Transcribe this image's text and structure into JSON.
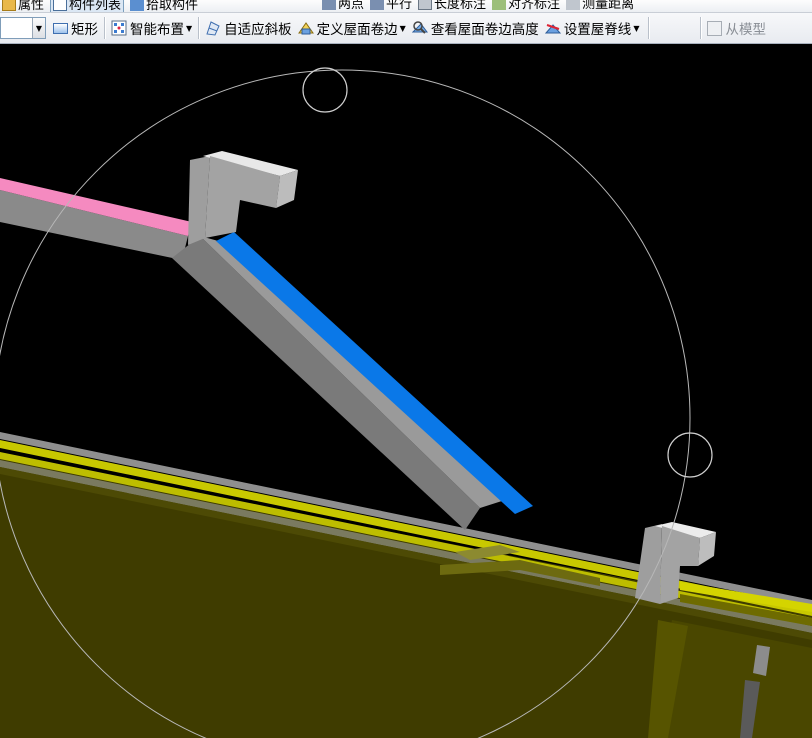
{
  "top_toolbar": {
    "left_items": [
      {
        "label": "属性",
        "icon": "properties-icon"
      },
      {
        "label": "构件列表",
        "icon": "component-list-icon"
      },
      {
        "label": "拾取构件",
        "icon": "pick-component-icon"
      }
    ],
    "right_items": [
      {
        "label": "两点",
        "icon": "two-point-icon"
      },
      {
        "label": "平行",
        "icon": "parallel-icon"
      },
      {
        "label": "长度标注",
        "icon": "length-annotation-icon"
      },
      {
        "label": "对齐标注",
        "icon": "align-annotation-icon"
      },
      {
        "label": "测量距离",
        "icon": "measure-distance-icon"
      }
    ]
  },
  "main_toolbar": {
    "combo_value": "",
    "buttons": [
      {
        "label": "矩形",
        "icon": "rectangle-icon",
        "dropdown": false
      },
      {
        "label": "智能布置",
        "icon": "smart-layout-icon",
        "dropdown": true
      },
      {
        "label": "自适应斜板",
        "icon": "adaptive-slab-icon",
        "dropdown": false
      },
      {
        "label": "定义屋面卷边",
        "icon": "define-roof-edge-icon",
        "dropdown": true
      },
      {
        "label": "查看屋面卷边高度",
        "icon": "view-edge-height-icon",
        "dropdown": false
      },
      {
        "label": "设置屋脊线",
        "icon": "set-ridge-line-icon",
        "dropdown": true
      }
    ],
    "right_button": {
      "label": "从模型",
      "icon": "from-model-icon"
    }
  },
  "colors": {
    "background": "#000000",
    "roof_pink": "#f58ac0",
    "roof_blue": "#0a78e8",
    "slab_olive": "#3f3c00",
    "edge_yellow": "#c8c800",
    "wall_gray": "#8c8c8c"
  }
}
